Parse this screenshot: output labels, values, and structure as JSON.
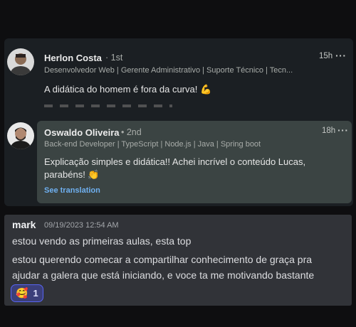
{
  "comments": [
    {
      "name": "Herlon Costa",
      "degree": "1st",
      "headline": "Desenvolvedor Web | Gerente Administrativo | Suporte Técnico | Tecn...",
      "time": "15h",
      "text": "A didática do homem é fora da curva! 💪",
      "avatar_icon": "person-photo-icon"
    },
    {
      "name": "Oswaldo Oliveira",
      "degree": "2nd",
      "headline": "Back-end Developer | TypeScript | Node.js | Java | Spring boot",
      "time": "18h",
      "text_line1": "Explicação simples e didática!! Achei incrível o conteúdo Lucas,",
      "text_line2": "parabéns! 👏",
      "translation_link": "See translation",
      "avatar_icon": "person-photo-icon"
    }
  ],
  "discord_message": {
    "author": "mark",
    "timestamp": "09/19/2023 12:54 AM",
    "line1": "estou vendo as primeiras aulas, esta top",
    "line2": "estou querendo comecar a compartilhar conhecimento de graça pra",
    "line3": "ajudar a galera que está iniciando, e voce ta me motivando bastante",
    "reaction_emoji": "🥰",
    "reaction_count": "1"
  },
  "colors": {
    "linkedin_bg": "#1b1f23",
    "comment_bubble": "#3b4443",
    "discord_bg": "#313338",
    "link_blue": "#6fb0f0",
    "reaction_border": "#5865f2"
  }
}
